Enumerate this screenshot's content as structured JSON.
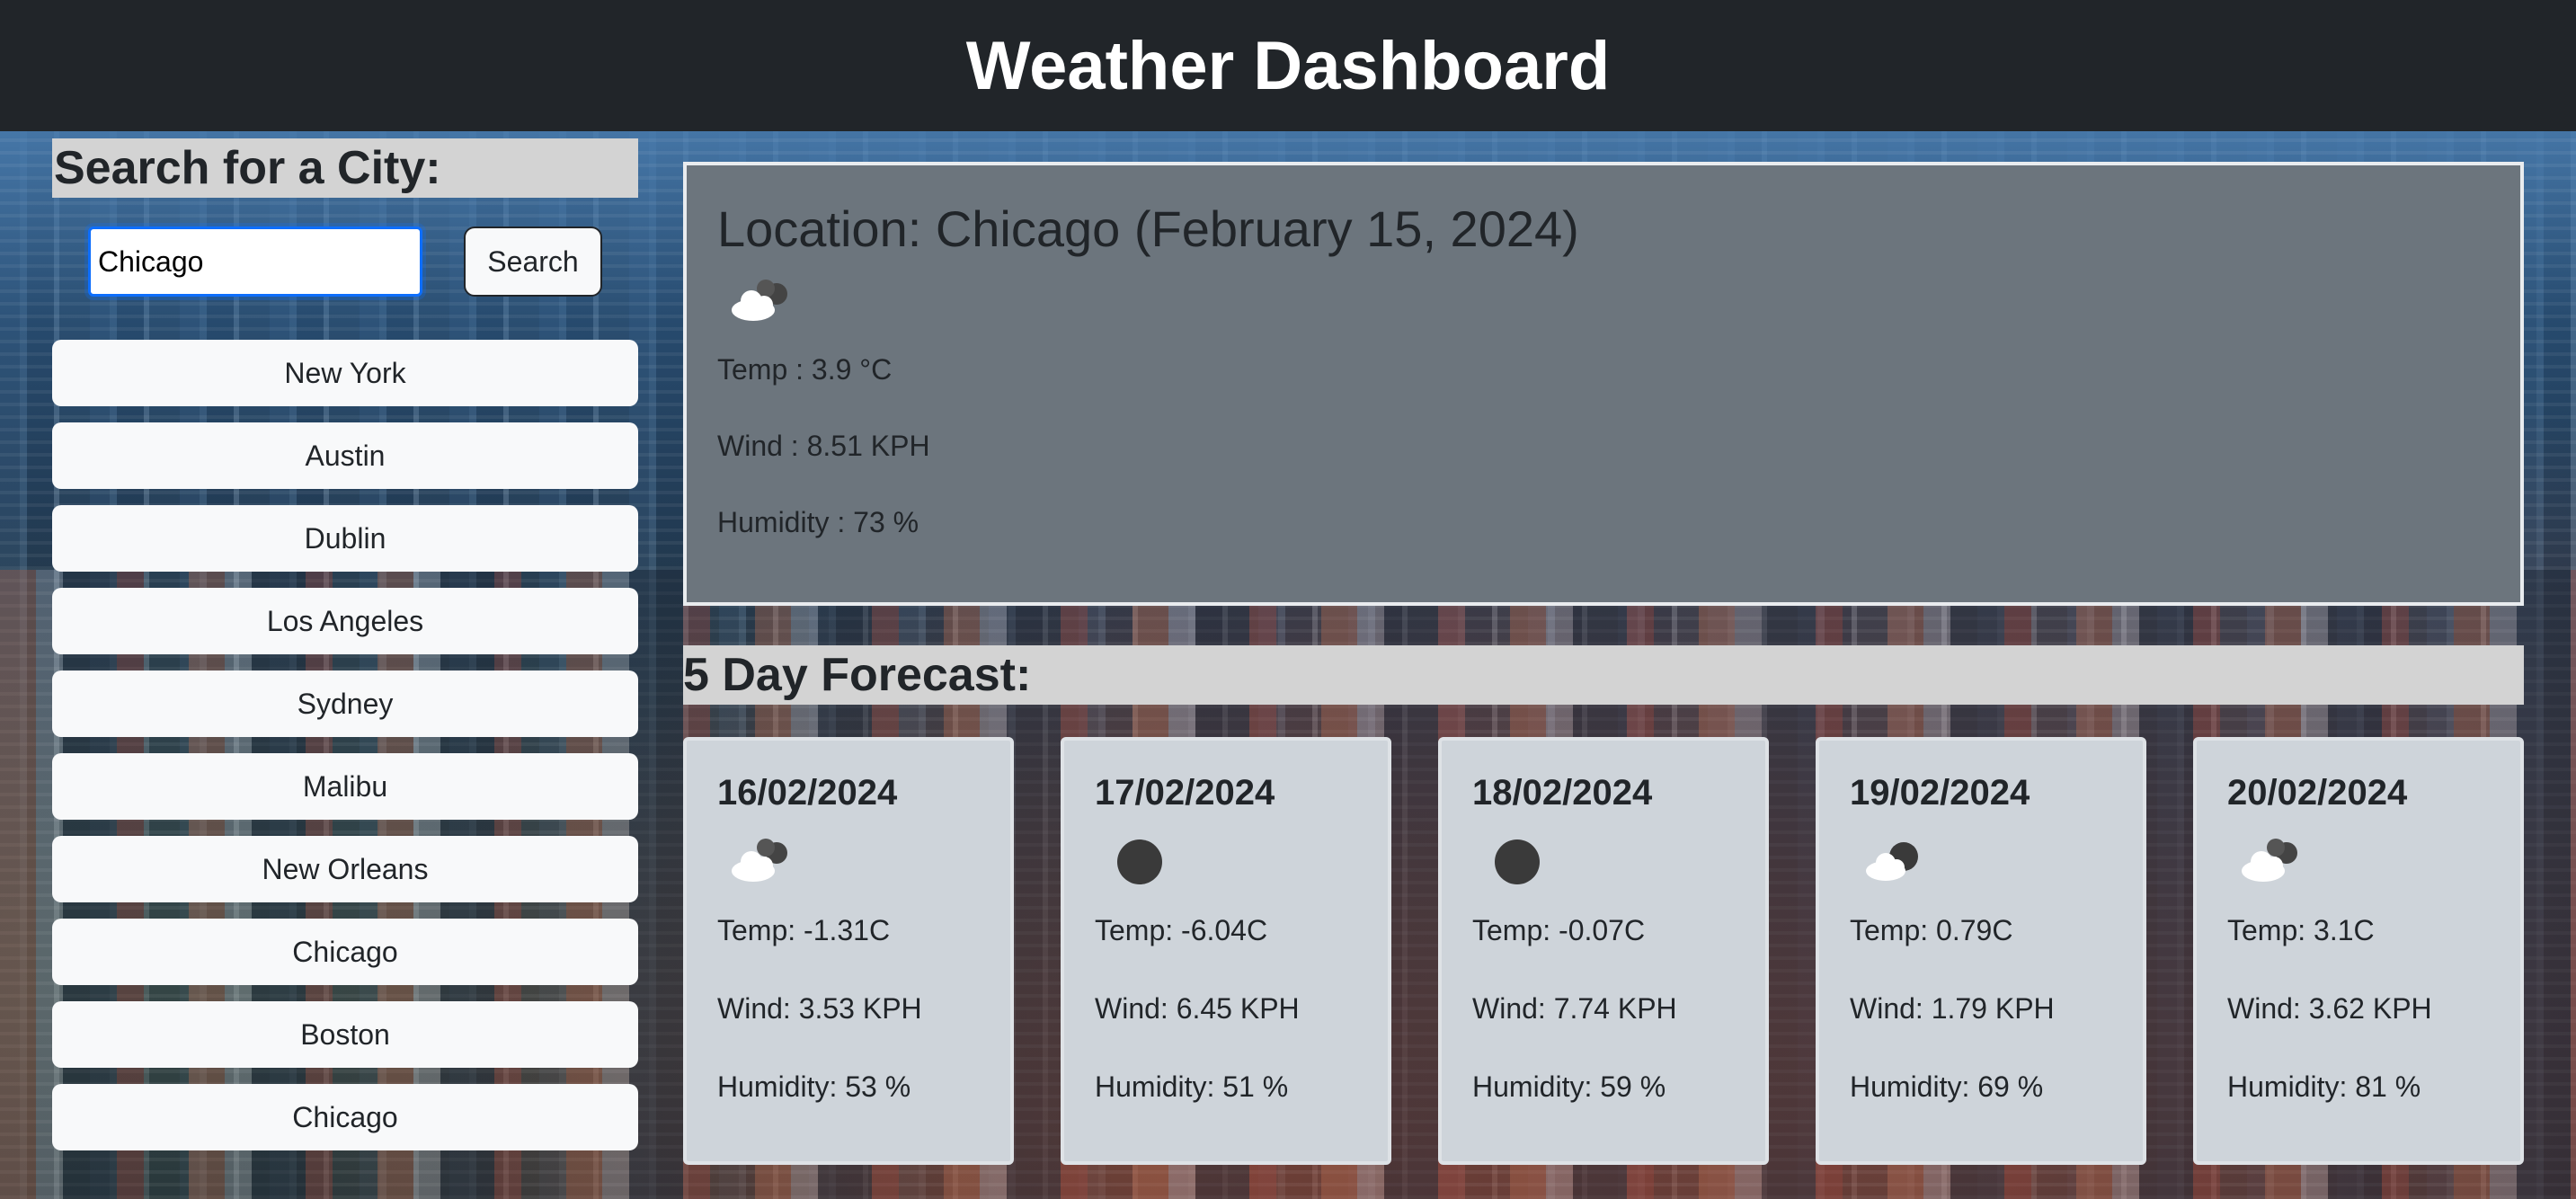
{
  "header": {
    "title": "Weather Dashboard"
  },
  "sidebar": {
    "heading": "Search for a City:",
    "search_value": "Chicago",
    "search_button": "Search",
    "history": [
      "New York",
      "Austin",
      "Dublin",
      "Los Angeles",
      "Sydney",
      "Malibu",
      "New Orleans",
      "Chicago",
      "Boston",
      "Chicago"
    ]
  },
  "current": {
    "title": "Location: Chicago (February 15, 2024)",
    "icon": "cloudy-icon",
    "temp": "Temp : 3.9 °C",
    "wind": "Wind : 8.51 KPH",
    "humidity": "Humidity : 73 %"
  },
  "forecast": {
    "heading": "5 Day Forecast:",
    "days": [
      {
        "date": "16/02/2024",
        "icon": "cloudy-icon",
        "temp": "Temp: -1.31C",
        "wind": "Wind: 3.53 KPH",
        "humidity": "Humidity: 53 %"
      },
      {
        "date": "17/02/2024",
        "icon": "clear-night-icon",
        "temp": "Temp: -6.04C",
        "wind": "Wind: 6.45 KPH",
        "humidity": "Humidity: 51 %"
      },
      {
        "date": "18/02/2024",
        "icon": "clear-night-icon",
        "temp": "Temp: -0.07C",
        "wind": "Wind: 7.74 KPH",
        "humidity": "Humidity: 59 %"
      },
      {
        "date": "19/02/2024",
        "icon": "partly-cloudy-night-icon",
        "temp": "Temp: 0.79C",
        "wind": "Wind: 1.79 KPH",
        "humidity": "Humidity: 69 %"
      },
      {
        "date": "20/02/2024",
        "icon": "cloudy-icon",
        "temp": "Temp: 3.1C",
        "wind": "Wind: 3.62 KPH",
        "humidity": "Humidity: 81 %"
      }
    ]
  }
}
